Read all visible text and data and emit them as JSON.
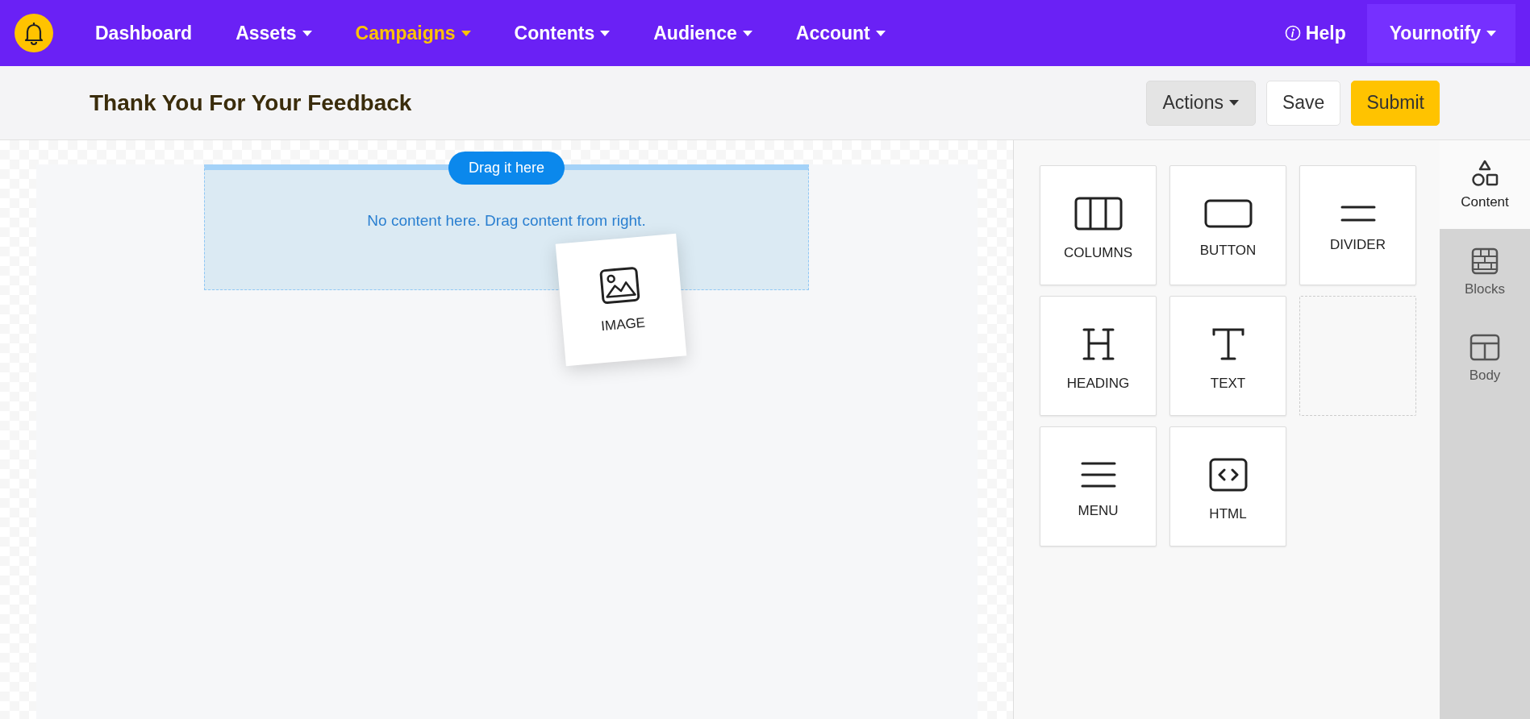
{
  "nav": {
    "items": [
      {
        "label": "Dashboard",
        "selected": false,
        "dropdown": false
      },
      {
        "label": "Assets",
        "selected": false,
        "dropdown": true
      },
      {
        "label": "Campaigns",
        "selected": true,
        "dropdown": true
      },
      {
        "label": "Contents",
        "selected": false,
        "dropdown": true
      },
      {
        "label": "Audience",
        "selected": false,
        "dropdown": true
      },
      {
        "label": "Account",
        "selected": false,
        "dropdown": true
      }
    ],
    "help": "Help",
    "account": "Yournotify"
  },
  "header": {
    "title": "Thank You For Your Feedback",
    "buttons": [
      {
        "label": "Actions",
        "kind": "dropdown"
      },
      {
        "label": "Save",
        "kind": "plain"
      },
      {
        "label": "Submit",
        "kind": "primary"
      }
    ]
  },
  "canvas": {
    "drop_hint": "Drag it here",
    "empty_message": "No content here. Drag content from right.",
    "dragged_item": {
      "label": "IMAGE"
    }
  },
  "tools": [
    {
      "kind": "tool",
      "label": "COLUMNS"
    },
    {
      "kind": "tool",
      "label": "BUTTON"
    },
    {
      "kind": "tool",
      "label": "DIVIDER"
    },
    {
      "kind": "tool",
      "label": "HEADING"
    },
    {
      "kind": "tool",
      "label": "TEXT"
    },
    {
      "kind": "empty"
    },
    {
      "kind": "tool",
      "label": "MENU"
    },
    {
      "kind": "tool",
      "label": "HTML"
    }
  ],
  "side_tabs": [
    {
      "label": "Content",
      "selected": true
    },
    {
      "label": "Blocks",
      "selected": false
    },
    {
      "label": "Body",
      "selected": false
    }
  ]
}
